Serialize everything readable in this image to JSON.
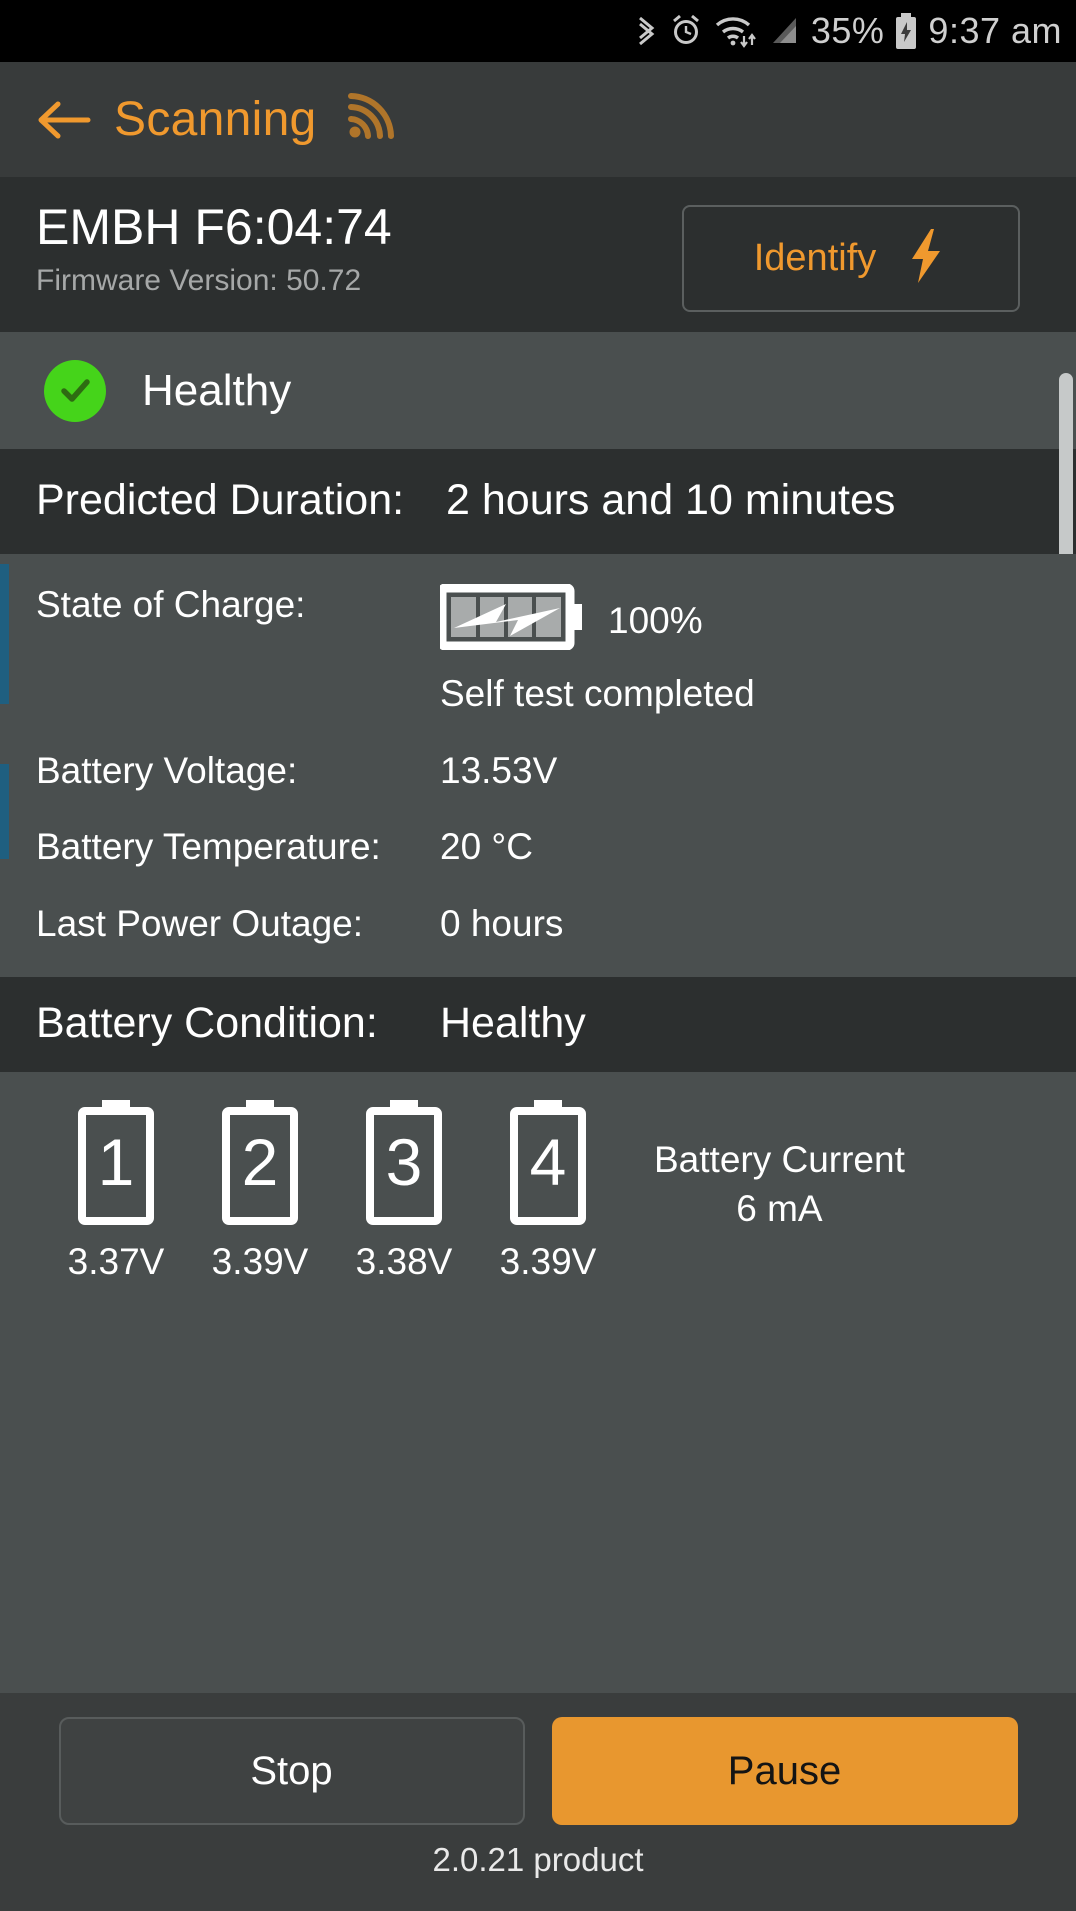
{
  "status_bar": {
    "icons": [
      "bluetooth-icon",
      "alarm-icon",
      "wifi-icon",
      "cellular-signal-icon",
      "battery-charging-icon"
    ],
    "battery_percent": "35%",
    "time": "9:37 am"
  },
  "app_bar": {
    "back_icon": "back-arrow-icon",
    "title": "Scanning",
    "scan_icon": "rss-signal-icon"
  },
  "device": {
    "name": "EMBH F6:04:74",
    "firmware": "Firmware Version: 50.72",
    "identify_label": "Identify",
    "identify_icon": "lightning-bolt-icon"
  },
  "health": {
    "icon": "green-check-circle-icon",
    "label": "Healthy"
  },
  "predicted": {
    "label": "Predicted Duration:",
    "value": "2 hours and 10 minutes"
  },
  "metrics": [
    {
      "label": "State of Charge:",
      "value": "100%",
      "note": "Self test completed",
      "icon": "battery-charging-horizontal-icon"
    },
    {
      "label": "Battery Voltage:",
      "value": "13.53V"
    },
    {
      "label": "Battery Temperature:",
      "value": "20 °C"
    },
    {
      "label": "Last Power Outage:",
      "value": "0 hours"
    }
  ],
  "condition": {
    "label": "Battery Condition:",
    "value": "Healthy"
  },
  "cells": [
    {
      "index": "1",
      "voltage": "3.37V"
    },
    {
      "index": "2",
      "voltage": "3.39V"
    },
    {
      "index": "3",
      "voltage": "3.38V"
    },
    {
      "index": "4",
      "voltage": "3.39V"
    }
  ],
  "current": {
    "label": "Battery Current",
    "value": "6 mA"
  },
  "footer": {
    "stop_label": "Stop",
    "pause_label": "Pause",
    "build": "2.0.21 product"
  },
  "colors": {
    "accent_orange": "#f0992e",
    "pause_orange": "#e8972f",
    "healthy_green": "#45d41a",
    "panel_dark": "#2c2f2f",
    "panel_light": "#4a4f4f"
  }
}
